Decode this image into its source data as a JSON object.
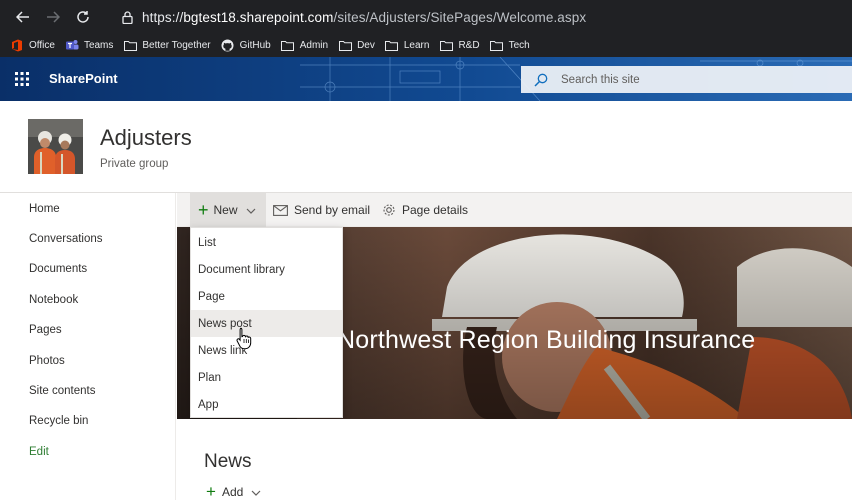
{
  "browser": {
    "url_scheme": "https://",
    "url_host": "bgtest18.sharepoint.com",
    "url_path": "/sites/Adjusters/SitePages/Welcome.aspx",
    "bookmarks": [
      {
        "label": "Office",
        "icon": "office-icon"
      },
      {
        "label": "Teams",
        "icon": "teams-icon"
      },
      {
        "label": "Better Together",
        "icon": "folder-icon"
      },
      {
        "label": "GitHub",
        "icon": "github-icon"
      },
      {
        "label": "Admin",
        "icon": "folder-icon"
      },
      {
        "label": "Dev",
        "icon": "folder-icon"
      },
      {
        "label": "Learn",
        "icon": "folder-icon"
      },
      {
        "label": "R&D",
        "icon": "folder-icon"
      },
      {
        "label": "Tech",
        "icon": "folder-icon"
      }
    ]
  },
  "suite": {
    "app_name": "SharePoint",
    "search_placeholder": "Search this site"
  },
  "site": {
    "title": "Adjusters",
    "subtitle": "Private group"
  },
  "nav": {
    "items": [
      "Home",
      "Conversations",
      "Documents",
      "Notebook",
      "Pages",
      "Photos",
      "Site contents",
      "Recycle bin"
    ],
    "edit_label": "Edit"
  },
  "commands": {
    "new_label": "New",
    "send_label": "Send by email",
    "details_label": "Page details"
  },
  "new_menu": {
    "items": [
      "List",
      "Document library",
      "Page",
      "News post",
      "News link",
      "Plan",
      "App"
    ],
    "hovered": "News post"
  },
  "hero": {
    "title": "Northwest Region Building Insurance"
  },
  "news": {
    "title": "News",
    "add_label": "Add"
  },
  "colors": {
    "suite_bar": "#0d3a78",
    "accent_green": "#107c10",
    "edit_green": "#2e7d32"
  }
}
